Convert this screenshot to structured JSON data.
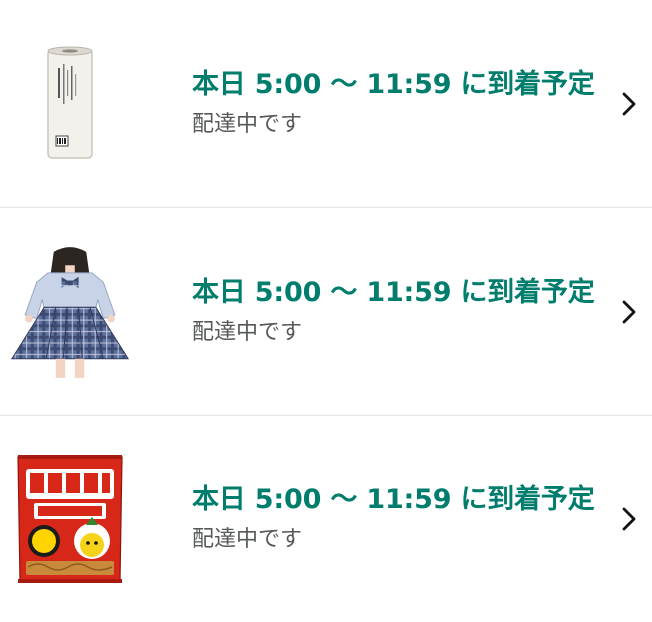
{
  "deliveries": [
    {
      "product_image": "lint-roller-refill",
      "title": "本日 5:00 〜 11:59 に到着予定",
      "status": "配達中です",
      "chevron_icon": "chevron-right-icon"
    },
    {
      "product_image": "plaid-school-uniform",
      "title": "本日 5:00 〜 11:59 に到着予定",
      "status": "配達中です",
      "chevron_icon": "chevron-right-icon"
    },
    {
      "product_image": "baby-star-ramen-snack",
      "title": "本日 5:00 〜 11:59 に到着予定",
      "status": "配達中です",
      "chevron_icon": "chevron-right-icon"
    }
  ],
  "colors": {
    "title": "#007d6c",
    "status": "#565959",
    "divider": "#e3e6e6"
  }
}
